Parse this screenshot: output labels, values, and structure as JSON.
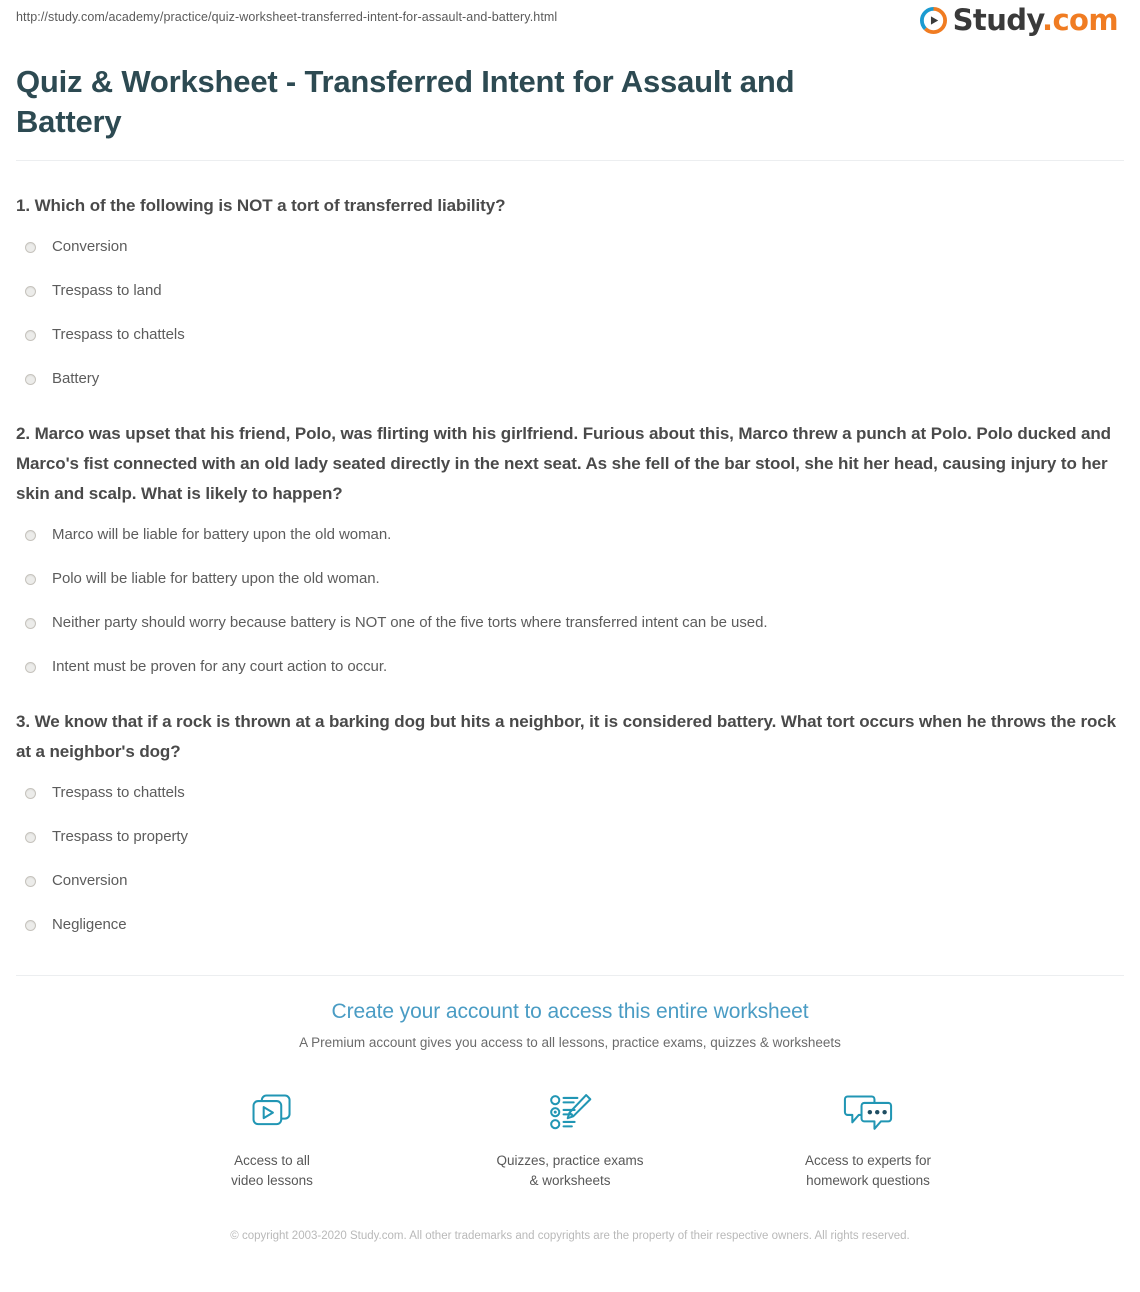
{
  "header": {
    "url": "http://study.com/academy/practice/quiz-worksheet-transferred-intent-for-assault-and-battery.html",
    "brand_name": "Study",
    "brand_suffix": ".com",
    "brand_dot_color": "#f07c22",
    "brand_ring_blue": "#1b9bd1",
    "brand_ring_orange": "#f07c22"
  },
  "title": "Quiz & Worksheet - Transferred Intent for Assault and Battery",
  "title_color": "#2d4a52",
  "questions": [
    {
      "text": "1. Which of the following is NOT a tort of transferred liability?",
      "options": [
        "Conversion",
        "Trespass to land",
        "Trespass to chattels",
        "Battery"
      ]
    },
    {
      "text": "2. Marco was upset that his friend, Polo, was flirting with his girlfriend. Furious about this, Marco threw a punch at Polo. Polo ducked and Marco's fist connected with an old lady seated directly in the next seat. As she fell of the bar stool, she hit her head, causing injury to her skin and scalp. What is likely to happen?",
      "options": [
        "Marco will be liable for battery upon the old woman.",
        "Polo will be liable for battery upon the old woman.",
        "Neither party should worry because battery is NOT one of the five torts where transferred intent can be used.",
        "Intent must be proven for any court action to occur."
      ]
    },
    {
      "text": "3. We know that if a rock is thrown at a barking dog but hits a neighbor, it is considered battery. What tort occurs when he throws the rock at a neighbor's dog?",
      "options": [
        "Trespass to chattels",
        "Trespass to property",
        "Conversion",
        "Negligence"
      ]
    }
  ],
  "cta": {
    "title": "Create your account to access this entire worksheet",
    "subtitle": "A Premium account gives you access to all lessons, practice exams, quizzes & worksheets",
    "accent_color": "#4a9cc4",
    "features": [
      {
        "icon": "video-lessons-icon",
        "label": "Access to all\nvideo lessons"
      },
      {
        "icon": "quiz-pencil-icon",
        "label": "Quizzes, practice exams\n& worksheets"
      },
      {
        "icon": "speech-bubbles-icon",
        "label": "Access to experts for\nhomework questions"
      }
    ],
    "icon_color": "#2196b4"
  },
  "copyright": "© copyright 2003-2020 Study.com. All other trademarks and copyrights are the property of their respective owners. All rights reserved."
}
